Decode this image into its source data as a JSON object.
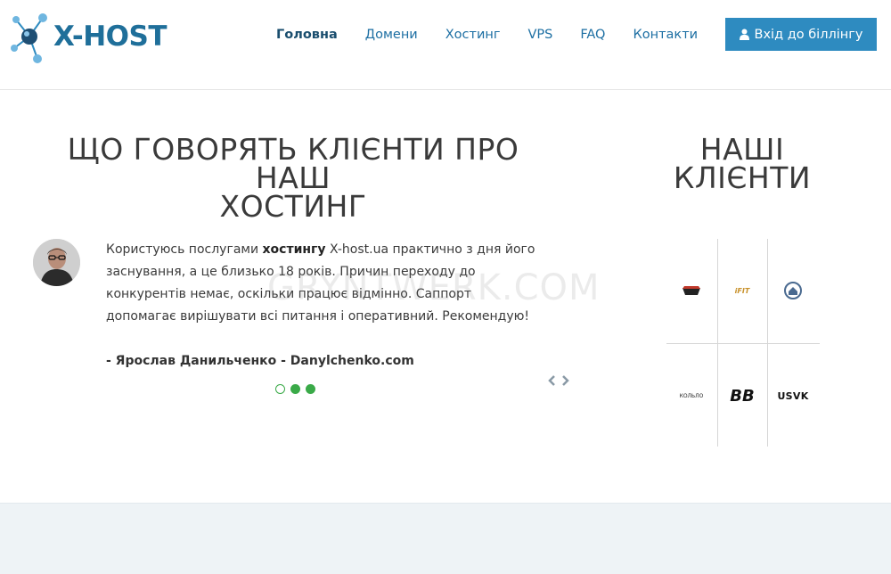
{
  "brand": {
    "name": "X-HOST",
    "logo_color": "#1f6f9a"
  },
  "nav": {
    "items": [
      {
        "label": "Головна",
        "active": true
      },
      {
        "label": "Домени",
        "active": false
      },
      {
        "label": "Хостинг",
        "active": false
      },
      {
        "label": "VPS",
        "active": false
      },
      {
        "label": "FAQ",
        "active": false
      },
      {
        "label": "Контакти",
        "active": false
      }
    ],
    "billing_label": "Вхід до біллінгу",
    "billing_icon": "user-icon"
  },
  "testimonials": {
    "title_line1": "ЩО ГОВОРЯТЬ КЛІЄНТИ ПРО НАШ",
    "title_line2": "ХОСТИНГ",
    "text_before": "Користуюсь послугами ",
    "text_bold": "хостингу",
    "text_after": " X-host.ua практично з дня його заснування, а це близько 18 років. Причин переходу до конкурентів немає, оскільки працює відмінно. Саппорт допомагає вирішувати всі питання і оперативний. Рекомендую!",
    "author": "- Ярослав Данильченко - Danylchenko.com",
    "slides_total": 3,
    "slide_active": 1
  },
  "clients": {
    "title_line1": "НАШІ",
    "title_line2": "КЛІЄНТИ",
    "logos": [
      {
        "name": "red-black-badge-logo",
        "text": ""
      },
      {
        "name": "ifit-logo",
        "text": "iFIT"
      },
      {
        "name": "round-house-logo",
        "text": ""
      },
      {
        "name": "text-logo",
        "text": "КОЛЬЛО"
      },
      {
        "name": "bb-logo",
        "text": "BB"
      },
      {
        "name": "usvk-logo",
        "text": "USVK"
      }
    ]
  },
  "watermark": "GRYNTWERK.COM",
  "colors": {
    "accent": "#2e8bc0",
    "nav_link": "#1d6fa3",
    "dot": "#3aaa48"
  }
}
